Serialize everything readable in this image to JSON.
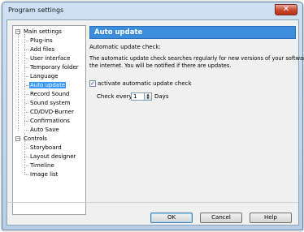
{
  "window": {
    "title": "Program settings",
    "close_glyph": "✕"
  },
  "tree": {
    "items": [
      {
        "label": "Main settings",
        "expander": "−"
      },
      {
        "label": "Plug-ins"
      },
      {
        "label": "Add files"
      },
      {
        "label": "User interface"
      },
      {
        "label": "Temporary folder"
      },
      {
        "label": "Language"
      },
      {
        "label": "Auto update",
        "selected": true
      },
      {
        "label": "Record Sound"
      },
      {
        "label": "Sound system"
      },
      {
        "label": "CD/DVD-Burner"
      },
      {
        "label": "Confirmations"
      },
      {
        "label": "Auto Save"
      },
      {
        "label": "Controls",
        "expander": "−"
      },
      {
        "label": "Storyboard"
      },
      {
        "label": "Layout designer"
      },
      {
        "label": "Timeline"
      },
      {
        "label": "Image list"
      }
    ]
  },
  "panel": {
    "header": "Auto update",
    "section_label": "Automatic update check:",
    "description_line1": "The automatic update check searches regularly for new versions of your software on",
    "description_line2": "the internet. You will be notified if there are updates.",
    "checkbox_label": "activate automatic update check",
    "checkbox_checked": true,
    "checkbox_mark": "✓",
    "check_every_label": "Check every:",
    "check_every_value": "1",
    "check_every_unit": "Days",
    "spin_up": "▲",
    "spin_down": "▼"
  },
  "buttons": {
    "ok": "OK",
    "cancel": "Cancel",
    "help": "Help"
  }
}
